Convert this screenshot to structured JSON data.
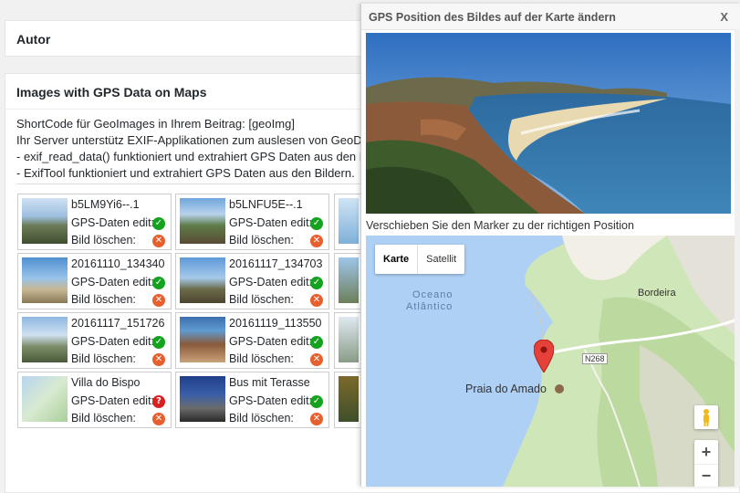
{
  "autor": {
    "title": "Autor"
  },
  "images_panel": {
    "title": "Images with GPS Data on Maps",
    "lines": [
      "ShortCode für GeoImages in Ihrem Beitrag: [geoImg]",
      "Ihr Server unterstütz EXIF-Applikationen zum auslesen von GeoDa",
      "- exif_read_data() funktioniert und extrahiert GPS Daten aus den B",
      "- ExifTool funktioniert und extrahiert GPS Daten aus den Bildern."
    ]
  },
  "gps_label": "GPS-Daten edit:",
  "delete_label": "Bild löschen:",
  "tiles": [
    {
      "name": "b5LM9Yi6--.1",
      "gps_status": "ok"
    },
    {
      "name": "b5LNFU5E--.1",
      "gps_status": "ok"
    },
    {
      "name": "20161110_134340",
      "gps_status": "ok"
    },
    {
      "name": "20161117_134703",
      "gps_status": "ok"
    },
    {
      "name": "20161117_151726",
      "gps_status": "ok"
    },
    {
      "name": "20161119_113550",
      "gps_status": "ok"
    },
    {
      "name": "Villa do Bispo",
      "gps_status": "missing"
    },
    {
      "name": "Bus mit Terasse",
      "gps_status": "ok"
    }
  ],
  "modal": {
    "title": "GPS Position des Bildes auf der Karte ändern",
    "close": "X",
    "hint": "Verschieben Sie den Marker zu der richtigen Position",
    "map": {
      "type_buttons": [
        "Karte",
        "Satellit"
      ],
      "selected_type": "Karte",
      "ocean_label_1": "Oceano",
      "ocean_label_2": "Atlântico",
      "town_label": "Bordeira",
      "road_label": "N268",
      "place_label": "Praia do Amado",
      "zoom_in": "+",
      "zoom_out": "−"
    }
  },
  "colors": {
    "ok": "#14a31e",
    "delete": "#e85f2e",
    "missing": "#d92020"
  }
}
